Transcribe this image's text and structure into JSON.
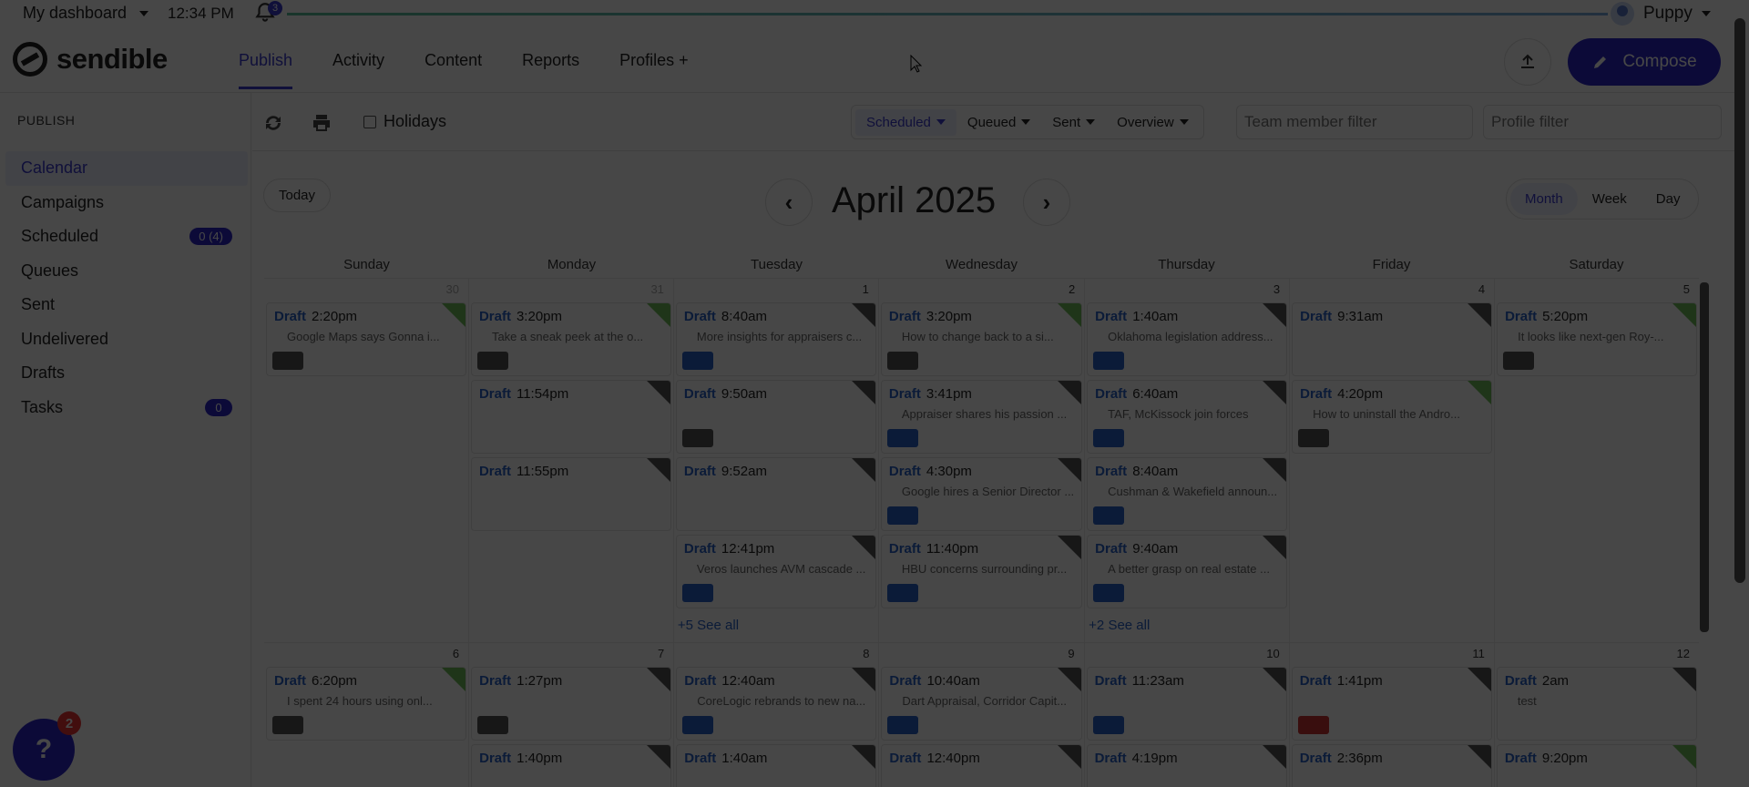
{
  "topbar": {
    "dashboard_label": "My dashboard",
    "time": "12:34 PM",
    "notifications": "3",
    "user": "Puppy"
  },
  "header": {
    "logo": "sendible",
    "nav": [
      "Publish",
      "Activity",
      "Content",
      "Reports",
      "Profiles +"
    ],
    "compose": "Compose"
  },
  "sidebar": {
    "heading": "PUBLISH",
    "items": [
      {
        "label": "Calendar",
        "count": ""
      },
      {
        "label": "Campaigns",
        "count": ""
      },
      {
        "label": "Scheduled",
        "count": "0 (4)"
      },
      {
        "label": "Queues",
        "count": ""
      },
      {
        "label": "Sent",
        "count": ""
      },
      {
        "label": "Undelivered",
        "count": ""
      },
      {
        "label": "Drafts",
        "count": ""
      },
      {
        "label": "Tasks",
        "count": "0"
      }
    ]
  },
  "toolbar": {
    "holidays": "Holidays",
    "filters": [
      "Scheduled",
      "Queued",
      "Sent",
      "Overview"
    ],
    "team_filter_placeholder": "Team member filter",
    "profile_filter_placeholder": "Profile filter"
  },
  "calendar": {
    "today": "Today",
    "title": "April 2025",
    "views": [
      "Month",
      "Week",
      "Day"
    ],
    "weekdays": [
      "Sunday",
      "Monday",
      "Tuesday",
      "Wednesday",
      "Thursday",
      "Friday",
      "Saturday"
    ],
    "weeks": [
      {
        "days": [
          {
            "num": "30",
            "other": true,
            "posts": [
              {
                "time": "2:20pm",
                "desc": "Google Maps says Gonna i...",
                "chip": "#555",
                "corner": "green"
              }
            ]
          },
          {
            "num": "31",
            "other": true,
            "posts": [
              {
                "time": "3:20pm",
                "desc": "Take a sneak peek at the o...",
                "chip": "#555",
                "corner": "green"
              },
              {
                "time": "11:54pm",
                "desc": "",
                "chip": "",
                "corner": "dark"
              },
              {
                "time": "11:55pm",
                "desc": "",
                "chip": "",
                "corner": "dark"
              }
            ]
          },
          {
            "num": "1",
            "other": false,
            "posts": [
              {
                "time": "8:40am",
                "desc": "More insights for appraisers c...",
                "chip": "#2a62c9",
                "corner": "dark"
              },
              {
                "time": "9:50am",
                "desc": "",
                "chip": "#555",
                "corner": "dark"
              },
              {
                "time": "9:52am",
                "desc": "",
                "chip": "",
                "corner": "dark"
              },
              {
                "time": "12:41pm",
                "desc": "Veros launches AVM cascade ...",
                "chip": "#2a62c9",
                "corner": "dark"
              }
            ],
            "seeall": "+5 See all"
          },
          {
            "num": "2",
            "other": false,
            "posts": [
              {
                "time": "3:20pm",
                "desc": "How to change back to a si...",
                "chip": "#555",
                "corner": "green"
              },
              {
                "time": "3:41pm",
                "desc": "Appraiser shares his passion ...",
                "chip": "#2a62c9",
                "corner": "dark"
              },
              {
                "time": "4:30pm",
                "desc": "Google hires a Senior Director ...",
                "chip": "#2a62c9",
                "corner": "dark"
              },
              {
                "time": "11:40pm",
                "desc": "HBU concerns surrounding pr...",
                "chip": "#2a62c9",
                "corner": "dark"
              }
            ]
          },
          {
            "num": "3",
            "other": false,
            "posts": [
              {
                "time": "1:40am",
                "desc": "Oklahoma legislation address...",
                "chip": "#2a62c9",
                "corner": "dark"
              },
              {
                "time": "6:40am",
                "desc": "TAF, McKissock join forces",
                "chip": "#2a62c9",
                "corner": "dark"
              },
              {
                "time": "8:40am",
                "desc": "Cushman & Wakefield announ...",
                "chip": "#2a62c9",
                "corner": "dark"
              },
              {
                "time": "9:40am",
                "desc": "A better grasp on real estate ...",
                "chip": "#2a62c9",
                "corner": "dark"
              }
            ],
            "seeall": "+2 See all"
          },
          {
            "num": "4",
            "other": false,
            "posts": [
              {
                "time": "9:31am",
                "desc": "",
                "chip": "",
                "corner": "dark"
              },
              {
                "time": "4:20pm",
                "desc": "How to uninstall the Andro...",
                "chip": "#555",
                "corner": "green"
              }
            ]
          },
          {
            "num": "5",
            "other": false,
            "posts": [
              {
                "time": "5:20pm",
                "desc": "It looks like next-gen Roy-...",
                "chip": "#555",
                "corner": "green"
              }
            ]
          }
        ]
      },
      {
        "days": [
          {
            "num": "6",
            "other": false,
            "posts": [
              {
                "time": "6:20pm",
                "desc": "I spent 24 hours using onl...",
                "chip": "#555",
                "corner": "green"
              }
            ]
          },
          {
            "num": "7",
            "other": false,
            "posts": [
              {
                "time": "1:27pm",
                "desc": "",
                "chip": "#555",
                "corner": "dark"
              },
              {
                "time": "1:40pm",
                "desc": "",
                "chip": "",
                "corner": "dark"
              }
            ]
          },
          {
            "num": "8",
            "other": false,
            "posts": [
              {
                "time": "12:40am",
                "desc": "CoreLogic rebrands to new na...",
                "chip": "#2a62c9",
                "corner": "dark"
              },
              {
                "time": "1:40am",
                "desc": "",
                "chip": "",
                "corner": "dark"
              }
            ]
          },
          {
            "num": "9",
            "other": false,
            "posts": [
              {
                "time": "10:40am",
                "desc": "Dart Appraisal, Corridor Capit...",
                "chip": "#2a62c9",
                "corner": "dark"
              },
              {
                "time": "12:40pm",
                "desc": "",
                "chip": "",
                "corner": "dark"
              }
            ]
          },
          {
            "num": "10",
            "other": false,
            "posts": [
              {
                "time": "11:23am",
                "desc": "",
                "chip": "#2a62c9",
                "corner": "dark"
              },
              {
                "time": "4:19pm",
                "desc": "",
                "chip": "",
                "corner": "dark"
              }
            ]
          },
          {
            "num": "11",
            "other": false,
            "posts": [
              {
                "time": "1:41pm",
                "desc": "",
                "chip": "#c33",
                "corner": "dark"
              },
              {
                "time": "2:36pm",
                "desc": "",
                "chip": "",
                "corner": "dark"
              }
            ]
          },
          {
            "num": "12",
            "other": false,
            "posts": [
              {
                "time": "2am",
                "desc": "test",
                "chip": "",
                "corner": "dark"
              },
              {
                "time": "9:20pm",
                "desc": "",
                "chip": "",
                "corner": "green"
              }
            ]
          }
        ]
      }
    ],
    "draft_label": "Draft"
  },
  "help": {
    "badge": "2"
  },
  "colors": {
    "accent": "#2b26c8",
    "link": "#2a62c9",
    "overlay": "rgba(0,0,0,0.72)"
  }
}
